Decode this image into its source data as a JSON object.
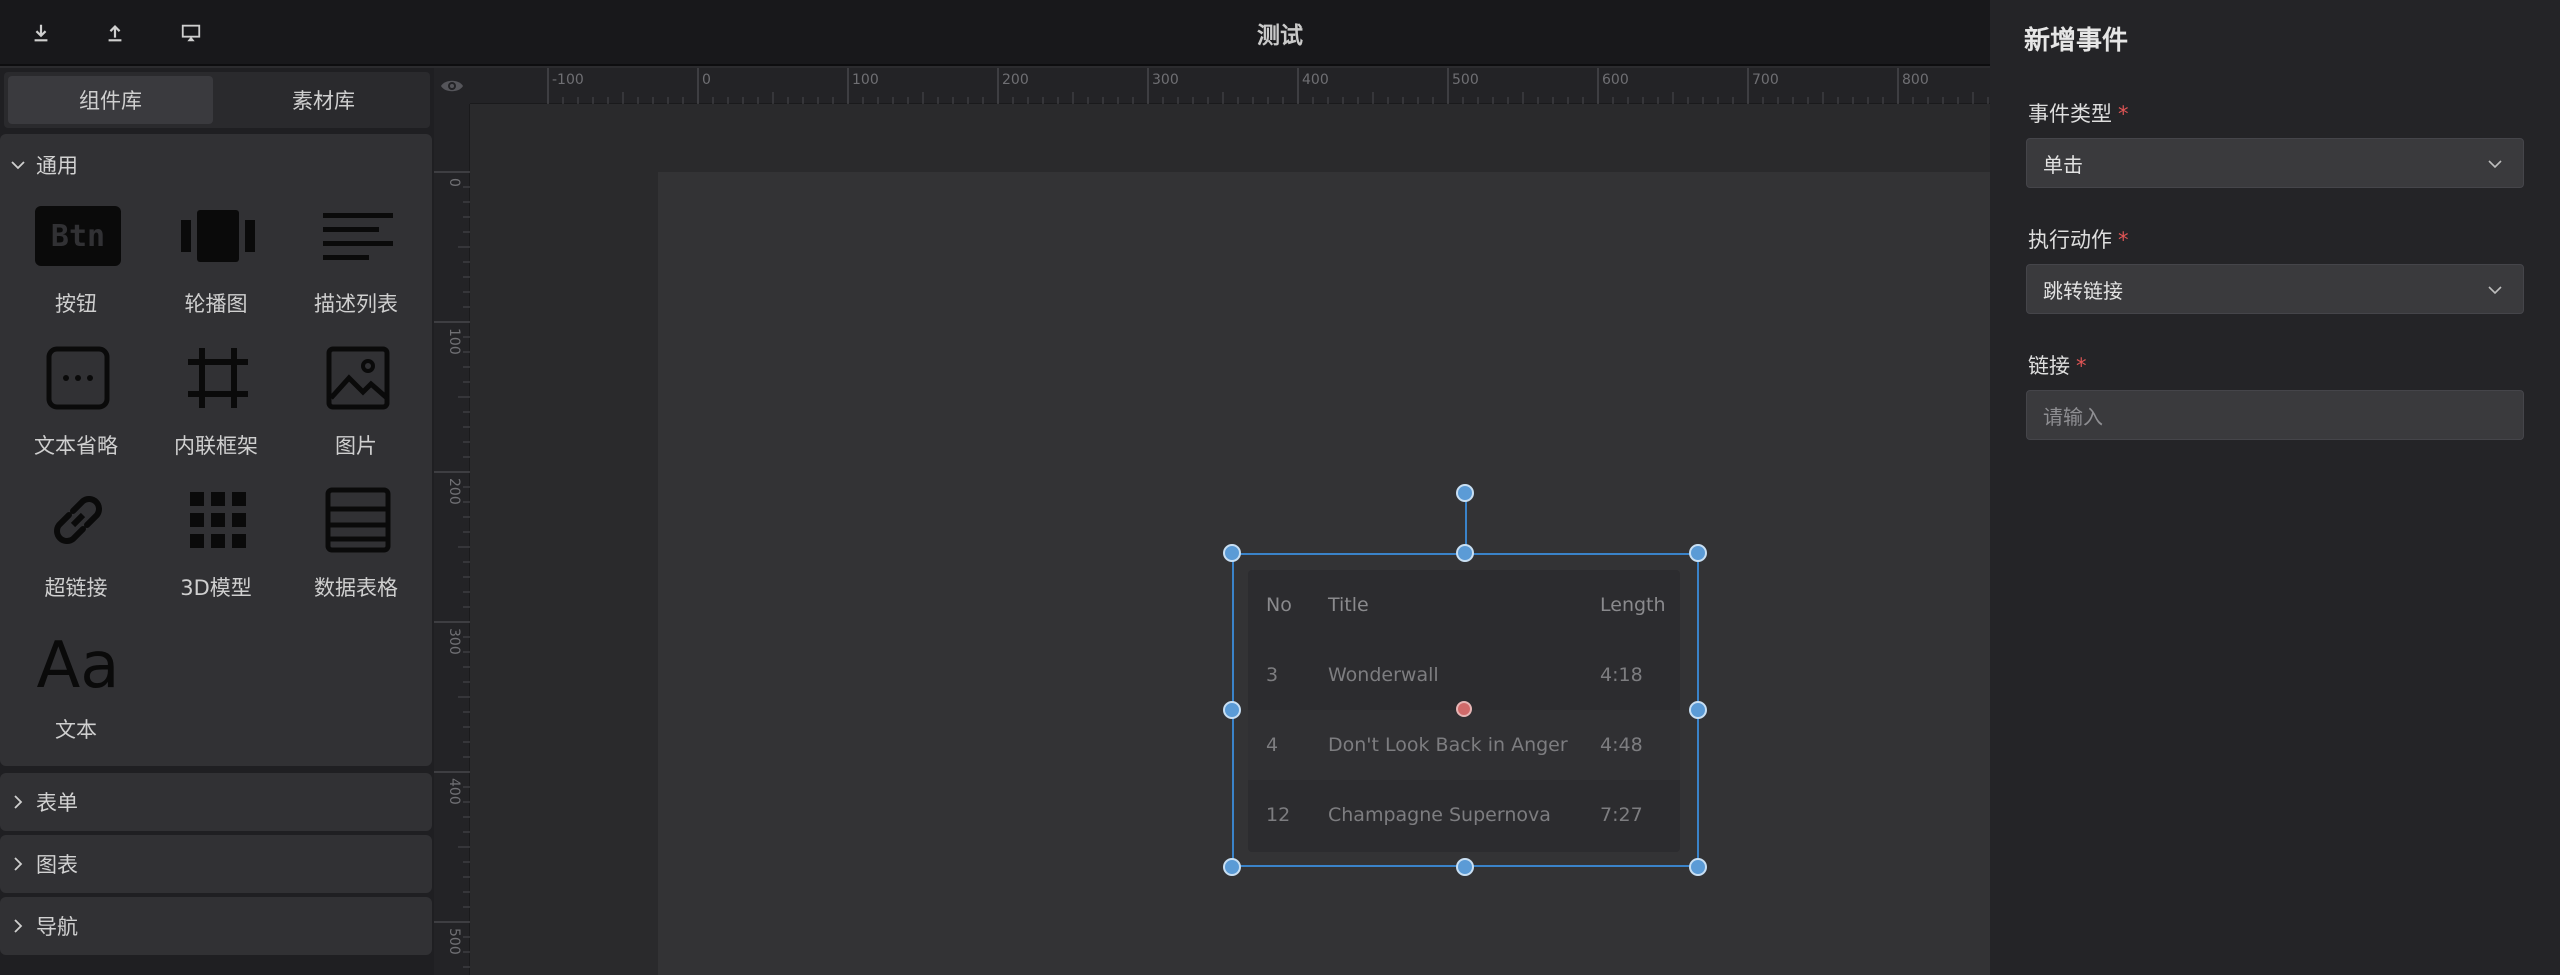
{
  "app": {
    "title": "测试"
  },
  "toolbar": {
    "icons": [
      "download-icon",
      "upload-icon",
      "preview-screen-icon"
    ]
  },
  "sidebar": {
    "tabs": [
      {
        "label": "组件库",
        "active": true
      },
      {
        "label": "素材库",
        "active": false
      }
    ],
    "categories": [
      {
        "label": "通用",
        "expanded": true,
        "components": [
          {
            "label": "按钮",
            "icon": "btn-icon"
          },
          {
            "label": "轮播图",
            "icon": "carousel-icon"
          },
          {
            "label": "描述列表",
            "icon": "description-list-icon"
          },
          {
            "label": "文本省略",
            "icon": "text-ellipsis-icon"
          },
          {
            "label": "内联框架",
            "icon": "iframe-icon"
          },
          {
            "label": "图片",
            "icon": "image-icon"
          },
          {
            "label": "超链接",
            "icon": "link-icon"
          },
          {
            "label": "3D模型",
            "icon": "grid-3d-icon"
          },
          {
            "label": "数据表格",
            "icon": "data-table-icon"
          },
          {
            "label": "文本",
            "icon": "text-aa-icon"
          }
        ]
      },
      {
        "label": "表单",
        "expanded": false
      },
      {
        "label": "图表",
        "expanded": false
      },
      {
        "label": "导航",
        "expanded": false
      }
    ],
    "btn_icon_text": "Btn",
    "text_icon_text": "Aa"
  },
  "ruler": {
    "h_labels": [
      "-100",
      "0",
      "100",
      "200",
      "300",
      "400",
      "500",
      "600",
      "700",
      "800"
    ],
    "v_labels": [
      "0",
      "100",
      "200",
      "300",
      "400",
      "500"
    ]
  },
  "table": {
    "headers": [
      "No",
      "Title",
      "Length"
    ],
    "rows": [
      [
        "3",
        "Wonderwall",
        "4:18"
      ],
      [
        "4",
        "Don't Look Back in Anger",
        "4:48"
      ],
      [
        "12",
        "Champagne Supernova",
        "7:27"
      ]
    ]
  },
  "panel": {
    "title": "新增事件",
    "fields": {
      "event_type": {
        "label": "事件类型",
        "value": "单击",
        "required": "*"
      },
      "action": {
        "label": "执行动作",
        "value": "跳转链接",
        "required": "*"
      },
      "link": {
        "label": "链接",
        "placeholder": "请输入",
        "required": "*"
      }
    }
  },
  "colors": {
    "selection": "#3a83c9",
    "required": "#e05555",
    "panel_bg": "#242427"
  }
}
